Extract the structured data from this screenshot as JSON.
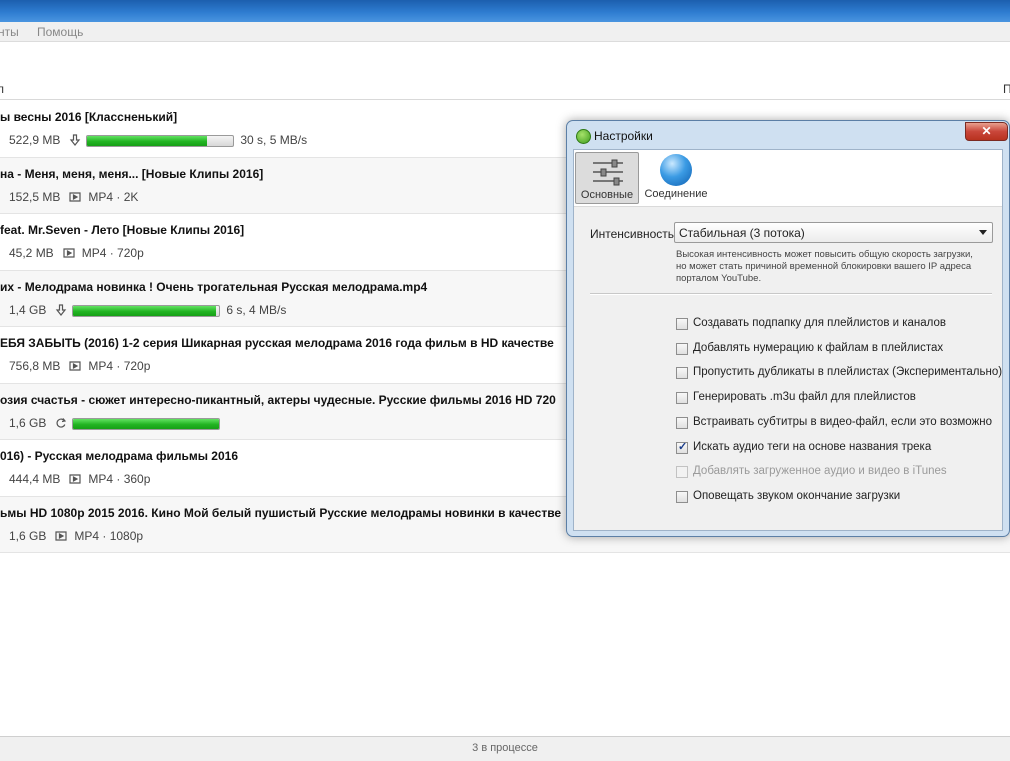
{
  "menu": {
    "left_fragment": "нты",
    "help": "Помощь"
  },
  "toolbar": {
    "left_fragment": "л",
    "right_fragment": "П"
  },
  "downloads": [
    {
      "title": "ы весны 2016 [Классненький]",
      "size": "522,9 MB",
      "state": "progress",
      "progress": 0.82,
      "speed": "30 s, 5 MB/s"
    },
    {
      "title": "на - Меня, меня, меня... [Новые Клипы 2016]",
      "size": "152,5 MB",
      "state": "done",
      "format": "MP4 · 2K"
    },
    {
      "title": "feat. Mr.Seven - Лето [Новые Клипы 2016]",
      "size": "45,2 MB",
      "state": "done",
      "format": "MP4 · 720p"
    },
    {
      "title": "их - Мелодрама новинка ! Очень трогательная Русская мелодрама.mp4",
      "size": "1,4 GB",
      "state": "progress",
      "progress": 0.98,
      "speed": "6 s, 4 MB/s"
    },
    {
      "title": "ЕБЯ ЗАБЫТЬ (2016) 1-2 серия   Шикарная русская мелодрама 2016 года   фильм в HD качестве",
      "size": "756,8 MB",
      "state": "done",
      "format": "MP4 · 720p"
    },
    {
      "title": "озия счастья - сюжет интересно-пикантный, актеры чудесные. Русские фильмы 2016 HD 720",
      "size": "1,6 GB",
      "state": "converting",
      "progress": 1.0,
      "speed": ""
    },
    {
      "title": "016) - Русская мелодрама фильмы 2016",
      "size": "444,4 MB",
      "state": "done",
      "format": "MP4 · 360p"
    },
    {
      "title": "ьмы HD 1080p 2015 2016. Кино   Мой белый пушистый  Русские мелодрамы новинки в качестве",
      "size": "1,6 GB",
      "state": "done",
      "format": "MP4 · 1080p"
    }
  ],
  "status": {
    "text": "3 в процессе"
  },
  "dialog": {
    "title": "Настройки",
    "close": "✕",
    "tabs": [
      {
        "label": "Основные",
        "icon": "sliders-icon",
        "active": true
      },
      {
        "label": "Соединение",
        "icon": "globe-icon",
        "active": false
      }
    ],
    "intensity_label": "Интенсивность",
    "intensity_value": "Стабильная (3 потока)",
    "hint": "Высокая интенсивность может повысить общую скорость загрузки, но может стать причиной временной блокировки вашего IP адреса порталом YouTube.",
    "options": [
      {
        "label": "Создавать подпапку для плейлистов и каналов",
        "checked": false,
        "disabled": false
      },
      {
        "label": "Добавлять нумерацию к файлам в плейлистах",
        "checked": false,
        "disabled": false
      },
      {
        "label": "Пропустить дубликаты в плейлистах (Экспериментально)",
        "checked": false,
        "disabled": false
      },
      {
        "label": "Генерировать .m3u файл для плейлистов",
        "checked": false,
        "disabled": false
      },
      {
        "label": "Встраивать субтитры в видео-файл, если это возможно",
        "checked": false,
        "disabled": false
      },
      {
        "label": "Искать аудио теги на основе названия трека",
        "checked": true,
        "disabled": false
      },
      {
        "label": "Добавлять загруженное аудио и видео в iTunes",
        "checked": false,
        "disabled": true
      },
      {
        "label": "Оповещать звуком окончание загрузки",
        "checked": false,
        "disabled": false
      }
    ]
  },
  "colors": {
    "progress": "#22b422",
    "title_bar": "#2e7cd0",
    "dialog_frame": "#cfe0f1"
  }
}
